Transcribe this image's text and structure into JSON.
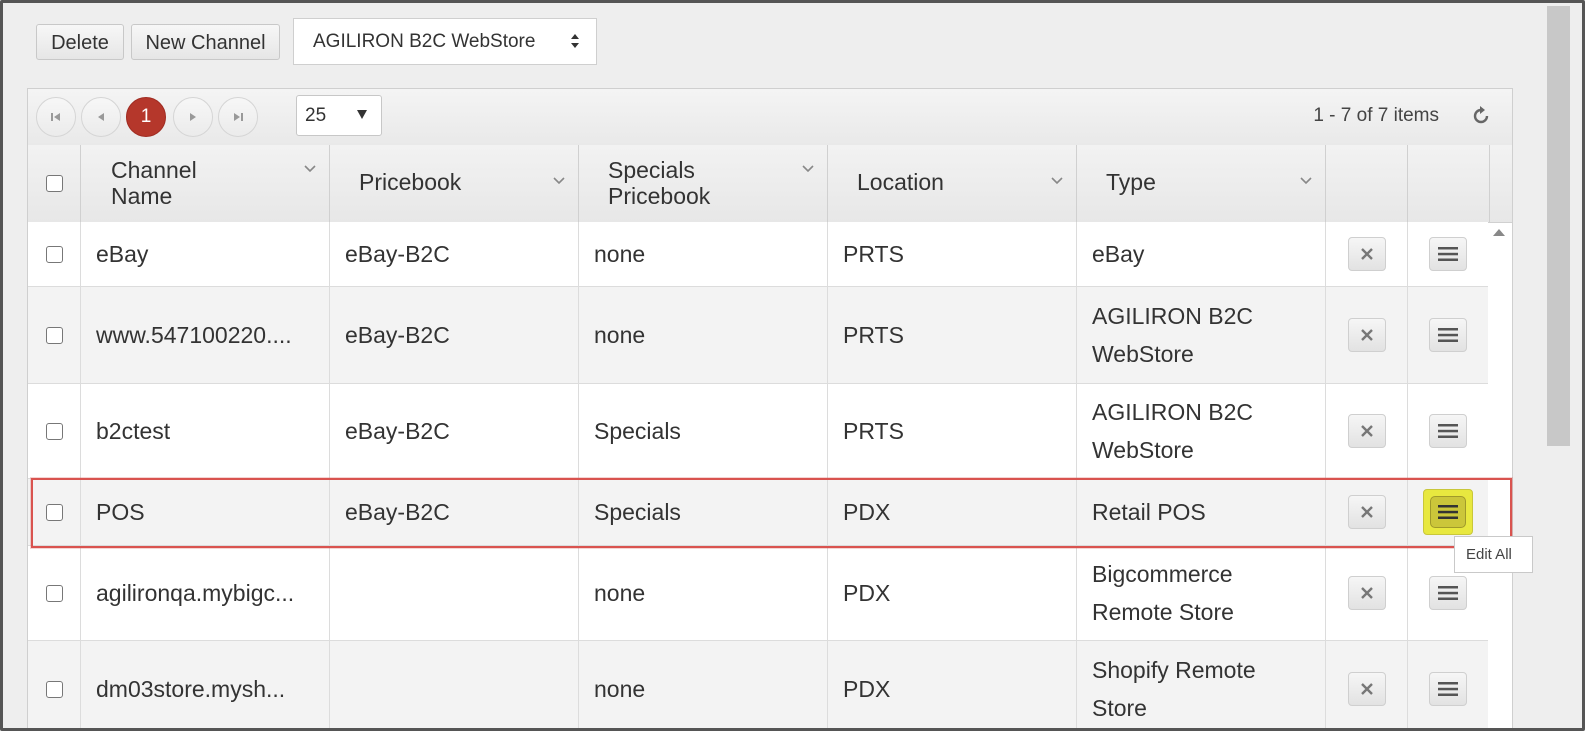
{
  "toolbar": {
    "delete_label": "Delete",
    "new_channel_label": "New Channel",
    "store_select_value": "AGILIRON B2C WebStore"
  },
  "pager": {
    "current_page": "1",
    "page_size": "25",
    "items_info": "1 - 7 of 7 items"
  },
  "columns": {
    "channel_name_line1": "Channel",
    "channel_name_line2": "Name",
    "pricebook": "Pricebook",
    "specials_line1": "Specials",
    "specials_line2": "Pricebook",
    "location": "Location",
    "type": "Type"
  },
  "rows": [
    {
      "name": "eBay",
      "pricebook": "eBay-B2C",
      "specials": "none",
      "location": "PRTS",
      "type_line1": "eBay",
      "type_line2": ""
    },
    {
      "name": "www.547100220....",
      "pricebook": "eBay-B2C",
      "specials": "none",
      "location": "PRTS",
      "type_line1": "AGILIRON B2C",
      "type_line2": "WebStore"
    },
    {
      "name": "b2ctest",
      "pricebook": "eBay-B2C",
      "specials": "Specials",
      "location": "PRTS",
      "type_line1": "AGILIRON B2C",
      "type_line2": "WebStore"
    },
    {
      "name": "POS",
      "pricebook": "eBay-B2C",
      "specials": "Specials",
      "location": "PDX",
      "type_line1": "Retail POS",
      "type_line2": ""
    },
    {
      "name": "agilironqa.mybigc...",
      "pricebook": "",
      "specials": "none",
      "location": "PDX",
      "type_line1": "Bigcommerce",
      "type_line2": "Remote Store"
    },
    {
      "name": "dm03store.mysh...",
      "pricebook": "",
      "specials": "none",
      "location": "PDX",
      "type_line1": "Shopify Remote",
      "type_line2": "Store"
    }
  ],
  "tooltip": "Edit All",
  "icons": {
    "delete_row": "close-icon",
    "row_menu": "hamburger-menu-icon",
    "refresh": "refresh-icon",
    "sort": "chevron-down-icon"
  },
  "colors": {
    "active_page": "#b5372b",
    "highlight": "#e8e83f",
    "selection_outline": "#d9534f"
  }
}
